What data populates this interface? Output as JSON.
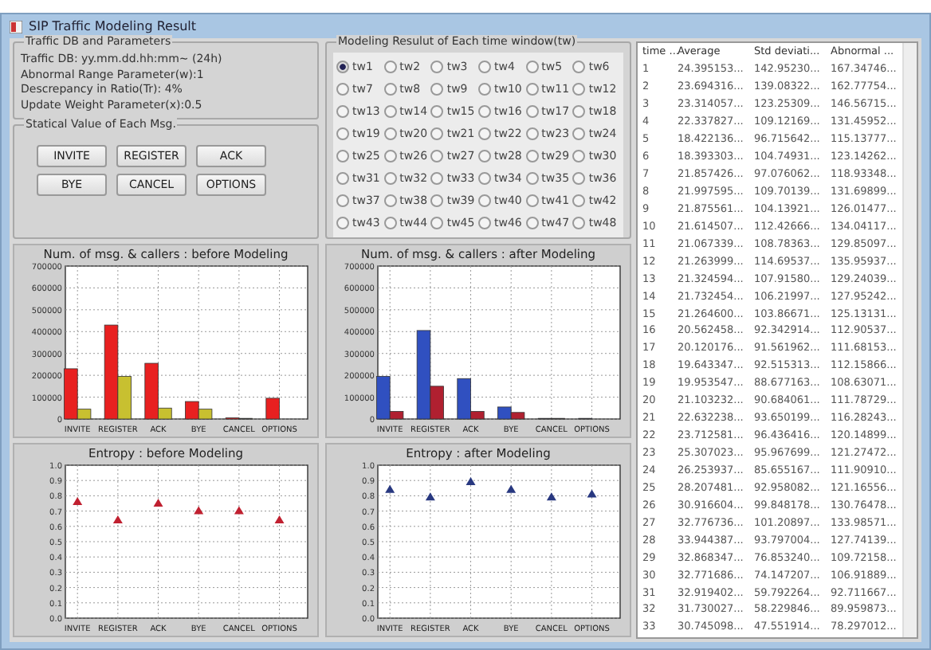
{
  "window": {
    "title": "SIP Traffic Modeling Result"
  },
  "parameters": {
    "title": "Traffic DB and Parameters",
    "lines": [
      "Traffic DB: yy.mm.dd.hh:mm~ (24h)",
      "Abnormal Range Parameter(w):1",
      "Descrepancy in Ratio(Tr): 4%",
      "Update Weight Parameter(x):0.5"
    ]
  },
  "messages": {
    "title": "Statical Value of Each Msg.",
    "buttons": [
      "INVITE",
      "REGISTER",
      "ACK",
      "BYE",
      "CANCEL",
      "OPTIONS"
    ]
  },
  "time_windows": {
    "title": "Modeling Resulut of Each time window(tw)",
    "options": [
      {
        "label": "tw1",
        "selected": true
      },
      {
        "label": "tw2",
        "selected": false
      },
      {
        "label": "tw3",
        "selected": false
      },
      {
        "label": "tw4",
        "selected": false
      },
      {
        "label": "tw5",
        "selected": false
      },
      {
        "label": "tw6",
        "selected": false
      },
      {
        "label": "tw7",
        "selected": false
      },
      {
        "label": "tw8",
        "selected": false
      },
      {
        "label": "tw9",
        "selected": false
      },
      {
        "label": "tw10",
        "selected": false
      },
      {
        "label": "tw11",
        "selected": false
      },
      {
        "label": "tw12",
        "selected": false
      },
      {
        "label": "tw13",
        "selected": false
      },
      {
        "label": "tw14",
        "selected": false
      },
      {
        "label": "tw15",
        "selected": false
      },
      {
        "label": "tw16",
        "selected": false
      },
      {
        "label": "tw17",
        "selected": false
      },
      {
        "label": "tw18",
        "selected": false
      },
      {
        "label": "tw19",
        "selected": false
      },
      {
        "label": "tw20",
        "selected": false
      },
      {
        "label": "tw21",
        "selected": false
      },
      {
        "label": "tw22",
        "selected": false
      },
      {
        "label": "tw23",
        "selected": false
      },
      {
        "label": "tw24",
        "selected": false
      },
      {
        "label": "tw25",
        "selected": false
      },
      {
        "label": "tw26",
        "selected": false
      },
      {
        "label": "tw27",
        "selected": false
      },
      {
        "label": "tw28",
        "selected": false
      },
      {
        "label": "tw29",
        "selected": false
      },
      {
        "label": "tw30",
        "selected": false
      },
      {
        "label": "tw31",
        "selected": false
      },
      {
        "label": "tw32",
        "selected": false
      },
      {
        "label": "tw33",
        "selected": false
      },
      {
        "label": "tw34",
        "selected": false
      },
      {
        "label": "tw35",
        "selected": false
      },
      {
        "label": "tw36",
        "selected": false
      },
      {
        "label": "tw37",
        "selected": false
      },
      {
        "label": "tw38",
        "selected": false
      },
      {
        "label": "tw39",
        "selected": false
      },
      {
        "label": "tw40",
        "selected": false
      },
      {
        "label": "tw41",
        "selected": false
      },
      {
        "label": "tw42",
        "selected": false
      },
      {
        "label": "tw43",
        "selected": false
      },
      {
        "label": "tw44",
        "selected": false
      },
      {
        "label": "tw45",
        "selected": false
      },
      {
        "label": "tw46",
        "selected": false
      },
      {
        "label": "tw47",
        "selected": false
      },
      {
        "label": "tw48",
        "selected": false
      }
    ]
  },
  "charts": [
    {
      "chart_data": {
        "type": "bar",
        "grid": true,
        "title": "Num. of msg. & callers : before Modeling",
        "categories": [
          "INVITE",
          "REGISTER",
          "ACK",
          "BYE",
          "CANCEL",
          "OPTIONS"
        ],
        "ylim": [
          0,
          700000
        ],
        "yticks": [
          0,
          100000,
          200000,
          300000,
          400000,
          500000,
          600000,
          700000
        ],
        "series": [
          {
            "color": "#e82020",
            "values": [
              230000,
              430000,
              255000,
              80000,
              5000,
              95000
            ]
          },
          {
            "color": "#c8c030",
            "values": [
              45000,
              195000,
              50000,
              45000,
              3000,
              0
            ]
          }
        ]
      }
    },
    {
      "chart_data": {
        "type": "bar",
        "grid": true,
        "title": "Num. of msg. & callers : after Modeling",
        "categories": [
          "INVITE",
          "REGISTER",
          "ACK",
          "BYE",
          "CANCEL",
          "OPTIONS"
        ],
        "ylim": [
          0,
          700000
        ],
        "yticks": [
          0,
          100000,
          200000,
          300000,
          400000,
          500000,
          600000,
          700000
        ],
        "series": [
          {
            "color": "#3050c0",
            "values": [
              195000,
              405000,
              185000,
              55000,
              3000,
              3000
            ]
          },
          {
            "color": "#b02030",
            "values": [
              35000,
              150000,
              35000,
              30000,
              3000,
              0
            ]
          }
        ]
      }
    },
    {
      "chart_data": {
        "type": "scatter",
        "grid": true,
        "title": "Entropy : before Modeling",
        "categories": [
          "INVITE",
          "REGISTER",
          "ACK",
          "BYE",
          "CANCEL",
          "OPTIONS"
        ],
        "ylim": [
          0,
          1
        ],
        "yticks": [
          {
            "value": 0,
            "label": "0.0"
          },
          {
            "value": 0.1,
            "label": "0.1"
          },
          {
            "value": 0.2,
            "label": "0.2"
          },
          {
            "value": 0.3,
            "label": "0.3"
          },
          {
            "value": 0.4,
            "label": "0.4"
          },
          {
            "value": 0.5,
            "label": "0.5"
          },
          {
            "value": 0.6,
            "label": "0.6"
          },
          {
            "value": 0.7,
            "label": "0.7"
          },
          {
            "value": 0.8,
            "label": "0.8"
          },
          {
            "value": 0.9,
            "label": "0.9"
          },
          {
            "value": 1,
            "label": "1.0"
          }
        ],
        "series": [
          {
            "color": "#c02030",
            "values": [
              0.76,
              0.64,
              0.75,
              0.7,
              0.7,
              0.64
            ]
          }
        ]
      }
    },
    {
      "chart_data": {
        "type": "scatter",
        "grid": true,
        "title": "Entropy : after Modeling",
        "categories": [
          "INVITE",
          "REGISTER",
          "ACK",
          "BYE",
          "CANCEL",
          "OPTIONS"
        ],
        "ylim": [
          0,
          1
        ],
        "yticks": [
          {
            "value": 0,
            "label": "0.0"
          },
          {
            "value": 0.1,
            "label": "0.1"
          },
          {
            "value": 0.2,
            "label": "0.2"
          },
          {
            "value": 0.3,
            "label": "0.3"
          },
          {
            "value": 0.4,
            "label": "0.4"
          },
          {
            "value": 0.5,
            "label": "0.5"
          },
          {
            "value": 0.6,
            "label": "0.6"
          },
          {
            "value": 0.7,
            "label": "0.7"
          },
          {
            "value": 0.8,
            "label": "0.8"
          },
          {
            "value": 0.9,
            "label": "0.9"
          },
          {
            "value": 1,
            "label": "1.0"
          }
        ],
        "series": [
          {
            "color": "#283880",
            "values": [
              0.84,
              0.79,
              0.89,
              0.84,
              0.79,
              0.81
            ]
          }
        ]
      }
    }
  ],
  "table": {
    "columns": [
      "time ...",
      "Average",
      "Std deviati...",
      "Abnormal ..."
    ],
    "rows": [
      [
        "1",
        "24.395153...",
        "142.95230...",
        "167.34746..."
      ],
      [
        "2",
        "23.694316...",
        "139.08322...",
        "162.77754..."
      ],
      [
        "3",
        "23.314057...",
        "123.25309...",
        "146.56715..."
      ],
      [
        "4",
        "22.337827...",
        "109.12169...",
        "131.45952..."
      ],
      [
        "5",
        "18.422136...",
        "96.715642...",
        "115.13777..."
      ],
      [
        "6",
        "18.393303...",
        "104.74931...",
        "123.14262..."
      ],
      [
        "7",
        "21.857426...",
        "97.076062...",
        "118.93348..."
      ],
      [
        "8",
        "21.997595...",
        "109.70139...",
        "131.69899..."
      ],
      [
        "9",
        "21.875561...",
        "104.13921...",
        "126.01477..."
      ],
      [
        "10",
        "21.614507...",
        "112.42666...",
        "134.04117..."
      ],
      [
        "11",
        "21.067339...",
        "108.78363...",
        "129.85097..."
      ],
      [
        "12",
        "21.263999...",
        "114.69537...",
        "135.95937..."
      ],
      [
        "13",
        "21.324594...",
        "107.91580...",
        "129.24039..."
      ],
      [
        "14",
        "21.732454...",
        "106.21997...",
        "127.95242..."
      ],
      [
        "15",
        "21.264600...",
        "103.86671...",
        "125.13131..."
      ],
      [
        "16",
        "20.562458...",
        "92.342914...",
        "112.90537..."
      ],
      [
        "17",
        "20.120176...",
        "91.561962...",
        "111.68153..."
      ],
      [
        "18",
        "19.643347...",
        "92.515313...",
        "112.15866..."
      ],
      [
        "19",
        "19.953547...",
        "88.677163...",
        "108.63071..."
      ],
      [
        "20",
        "21.103232...",
        "90.684061...",
        "111.78729..."
      ],
      [
        "21",
        "22.632238...",
        "93.650199...",
        "116.28243..."
      ],
      [
        "22",
        "23.712581...",
        "96.436416...",
        "120.14899..."
      ],
      [
        "23",
        "25.307023...",
        "95.967699...",
        "121.27472..."
      ],
      [
        "24",
        "26.253937...",
        "85.655167...",
        "111.90910..."
      ],
      [
        "25",
        "28.207481...",
        "92.958082...",
        "121.16556..."
      ],
      [
        "26",
        "30.916604...",
        "99.848178...",
        "130.76478..."
      ],
      [
        "27",
        "32.776736...",
        "101.20897...",
        "133.98571..."
      ],
      [
        "28",
        "33.944387...",
        "93.797004...",
        "127.74139..."
      ],
      [
        "29",
        "32.868347...",
        "76.853240...",
        "109.72158..."
      ],
      [
        "30",
        "32.771686...",
        "74.147207...",
        "106.91889..."
      ],
      [
        "31",
        "32.919402...",
        "59.792264...",
        "92.711667..."
      ],
      [
        "32",
        "31.730027...",
        "58.229846...",
        "89.959873..."
      ],
      [
        "33",
        "30.745098...",
        "47.551914...",
        "78.297012..."
      ]
    ]
  }
}
